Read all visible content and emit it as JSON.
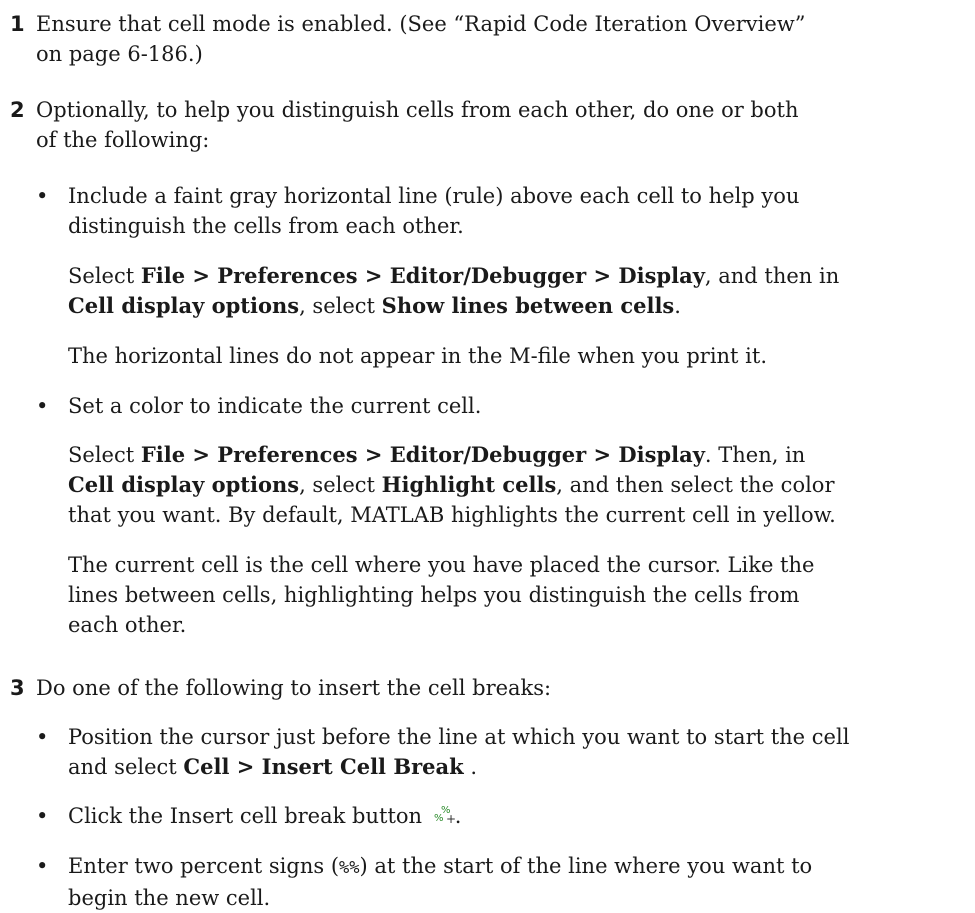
{
  "step1": {
    "num": "1",
    "a": "Ensure that cell mode is enabled. (See “Rapid Code Iteration Overview”",
    "b": "on page 6-186.)"
  },
  "step2": {
    "num": "2",
    "a": "Optionally, to help you distinguish cells from each other, do one or both",
    "b": "of the following:",
    "bullet1": {
      "a": "Include a faint gray horizontal line (rule) above each cell to help you",
      "b": "distinguish the cells from each other.",
      "sel_pre": "Select ",
      "sel_path": "File > Preferences > Editor/Debugger > Display",
      "sel_mid": ", and then in",
      "sel_opt": "Cell display options",
      "sel_mid2": ", select ",
      "sel_item": "Show lines between cells",
      "sel_end": ".",
      "note": "The horizontal lines do not appear in the M-file when you print it."
    },
    "bullet2": {
      "a": "Set a color to indicate the current cell.",
      "sel_pre": "Select ",
      "sel_path": "File > Preferences > Editor/Debugger > Display",
      "sel_mid": ". Then, in",
      "sel_opt": "Cell display options",
      "sel_mid2": ", select ",
      "sel_item": "Highlight cells",
      "sel_end": ", and then select the color",
      "c": "that you want. By default, MATLAB highlights the current cell in yellow.",
      "p1": "The current cell is the cell where you have placed the cursor. Like the",
      "p2": "lines between cells, highlighting helps you distinguish the cells from",
      "p3": "each other."
    }
  },
  "step3": {
    "num": "3",
    "a": "Do one of the following to insert the cell breaks:",
    "bullet1": {
      "a": "Position the cursor just before the line at which you want to start the cell",
      "b_pre": "and select ",
      "b_menu": "Cell > Insert Cell Break",
      "b_end": " ."
    },
    "bullet2": {
      "a": "Click the Insert cell break button",
      "end": ".",
      "icon": "insert-cell-break-icon"
    },
    "bullet3": {
      "a": "Enter two percent signs (",
      "code": "%%",
      "b": ") at the start of the line where you want to",
      "c": "begin the new cell."
    }
  },
  "bullet_char": "•"
}
